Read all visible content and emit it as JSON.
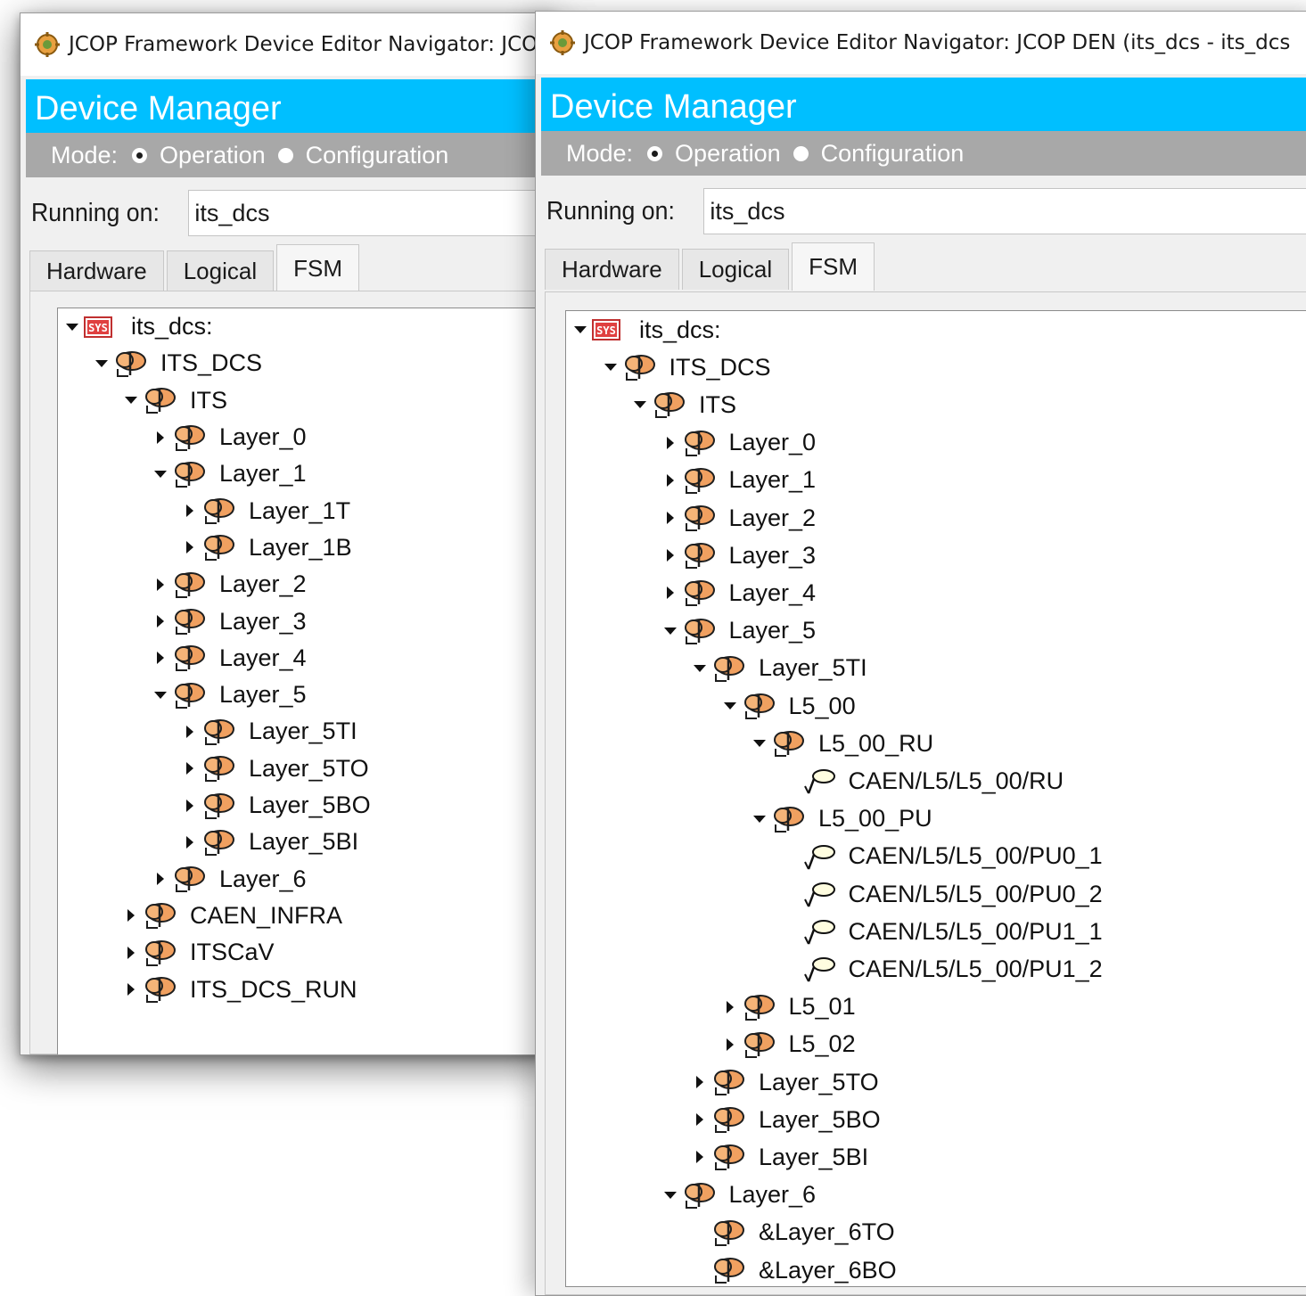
{
  "colors": {
    "header_bg": "#00bfff",
    "mode_bar_bg": "#a8a8a8",
    "window_bg": "#f0f0f0",
    "node_icon_orange": "#f0a060",
    "sys_icon_red": "#e04040"
  },
  "icons": {
    "app": "jcop-gear-icon",
    "system": "system-icon",
    "fsm_node": "fsm-node-icon",
    "device_unit": "device-unit-icon",
    "expand": "triangle-right-icon",
    "collapse": "triangle-down-icon"
  },
  "windows": [
    {
      "title": "JCOP Framework Device Editor Navigator: JCOP DEN (its_dcs - its_dcs",
      "header_title": "Device Manager",
      "mode": {
        "label": "Mode:",
        "options": [
          "Operation",
          "Configuration"
        ],
        "selected": "Operation"
      },
      "running_on_label": "Running on:",
      "running_on_value": "its_dcs",
      "tabs": [
        "Hardware",
        "Logical",
        "FSM"
      ],
      "active_tab": "FSM",
      "tree": [
        {
          "label": "its_dcs:",
          "type": "system",
          "state": "expanded"
        },
        {
          "label": "ITS_DCS",
          "type": "node",
          "state": "expanded"
        },
        {
          "label": "ITS",
          "type": "node",
          "state": "expanded"
        },
        {
          "label": "Layer_0",
          "type": "node",
          "state": "collapsed"
        },
        {
          "label": "Layer_1",
          "type": "node",
          "state": "expanded"
        },
        {
          "label": "Layer_1T",
          "type": "node",
          "state": "collapsed"
        },
        {
          "label": "Layer_1B",
          "type": "node",
          "state": "collapsed"
        },
        {
          "label": "Layer_2",
          "type": "node",
          "state": "collapsed"
        },
        {
          "label": "Layer_3",
          "type": "node",
          "state": "collapsed"
        },
        {
          "label": "Layer_4",
          "type": "node",
          "state": "collapsed"
        },
        {
          "label": "Layer_5",
          "type": "node",
          "state": "expanded"
        },
        {
          "label": "Layer_5TI",
          "type": "node",
          "state": "collapsed"
        },
        {
          "label": "Layer_5TO",
          "type": "node",
          "state": "collapsed"
        },
        {
          "label": "Layer_5BO",
          "type": "node",
          "state": "collapsed"
        },
        {
          "label": "Layer_5BI",
          "type": "node",
          "state": "collapsed"
        },
        {
          "label": "Layer_6",
          "type": "node",
          "state": "collapsed"
        },
        {
          "label": "CAEN_INFRA",
          "type": "node",
          "state": "collapsed"
        },
        {
          "label": "ITSCaV",
          "type": "node",
          "state": "collapsed"
        },
        {
          "label": "ITS_DCS_RUN",
          "type": "node",
          "state": "collapsed"
        }
      ]
    },
    {
      "title": "JCOP Framework Device Editor Navigator: JCOP DEN (its_dcs - its_dcs",
      "header_title": "Device Manager",
      "mode": {
        "label": "Mode:",
        "options": [
          "Operation",
          "Configuration"
        ],
        "selected": "Operation"
      },
      "running_on_label": "Running on:",
      "running_on_value": "its_dcs",
      "tabs": [
        "Hardware",
        "Logical",
        "FSM"
      ],
      "active_tab": "FSM",
      "tree": [
        {
          "label": "its_dcs:",
          "type": "system",
          "state": "expanded"
        },
        {
          "label": "ITS_DCS",
          "type": "node",
          "state": "expanded"
        },
        {
          "label": "ITS",
          "type": "node",
          "state": "expanded"
        },
        {
          "label": "Layer_0",
          "type": "node",
          "state": "collapsed"
        },
        {
          "label": "Layer_1",
          "type": "node",
          "state": "collapsed"
        },
        {
          "label": "Layer_2",
          "type": "node",
          "state": "collapsed"
        },
        {
          "label": "Layer_3",
          "type": "node",
          "state": "collapsed"
        },
        {
          "label": "Layer_4",
          "type": "node",
          "state": "collapsed"
        },
        {
          "label": "Layer_5",
          "type": "node",
          "state": "expanded"
        },
        {
          "label": "Layer_5TI",
          "type": "node",
          "state": "expanded"
        },
        {
          "label": "L5_00",
          "type": "node",
          "state": "expanded"
        },
        {
          "label": "L5_00_RU",
          "type": "node",
          "state": "expanded"
        },
        {
          "label": "CAEN/L5/L5_00/RU",
          "type": "device",
          "state": "leaf"
        },
        {
          "label": "L5_00_PU",
          "type": "node",
          "state": "expanded"
        },
        {
          "label": "CAEN/L5/L5_00/PU0_1",
          "type": "device",
          "state": "leaf"
        },
        {
          "label": "CAEN/L5/L5_00/PU0_2",
          "type": "device",
          "state": "leaf"
        },
        {
          "label": "CAEN/L5/L5_00/PU1_1",
          "type": "device",
          "state": "leaf"
        },
        {
          "label": "CAEN/L5/L5_00/PU1_2",
          "type": "device",
          "state": "leaf"
        },
        {
          "label": "L5_01",
          "type": "node",
          "state": "collapsed"
        },
        {
          "label": "L5_02",
          "type": "node",
          "state": "collapsed"
        },
        {
          "label": "Layer_5TO",
          "type": "node",
          "state": "collapsed"
        },
        {
          "label": "Layer_5BO",
          "type": "node",
          "state": "collapsed"
        },
        {
          "label": "Layer_5BI",
          "type": "node",
          "state": "collapsed"
        },
        {
          "label": "Layer_6",
          "type": "node",
          "state": "expanded"
        },
        {
          "label": "&Layer_6TO",
          "type": "node",
          "state": "leaf"
        },
        {
          "label": "&Layer_6BO",
          "type": "node",
          "state": "leaf"
        }
      ]
    }
  ]
}
